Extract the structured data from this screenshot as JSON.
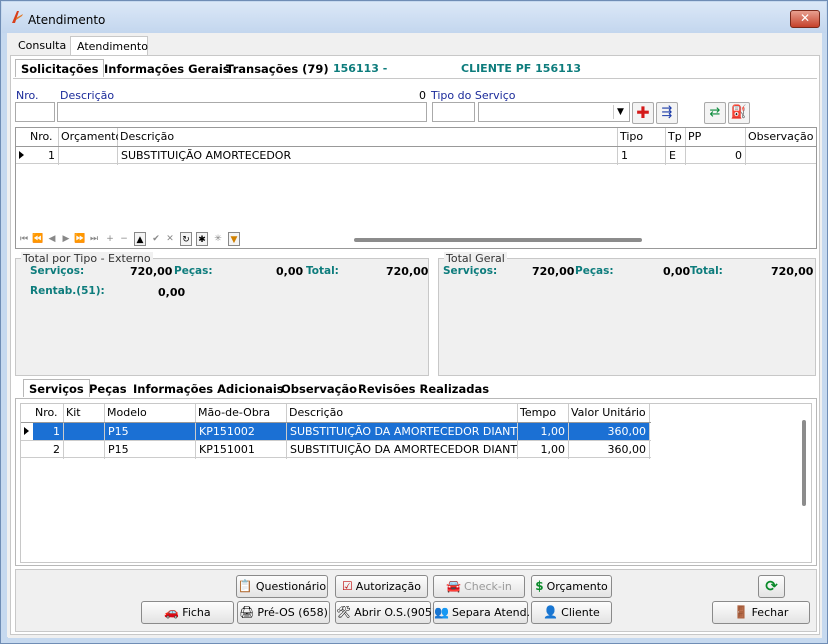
{
  "window": {
    "title": "Atendimento"
  },
  "top_tabs": [
    "Consulta",
    "Atendimento"
  ],
  "sub_tabs": [
    "Solicitações",
    "Informações Gerais",
    "Transações (79)"
  ],
  "header_info": {
    "number": "156113 -",
    "client": "CLIENTE PF 156113"
  },
  "form": {
    "nro_label": "Nro.",
    "descricao_label": "Descrição",
    "descricao_count": "0",
    "tipo_servico_label": "Tipo do Serviço"
  },
  "requests_grid": {
    "columns": [
      "Nro.",
      "Orçamento",
      "Descrição",
      "Tipo",
      "Tp",
      "PP",
      "Observação"
    ],
    "rows": [
      {
        "nro": "1",
        "orcamento": "",
        "descricao": "SUBSTITUIÇÃO AMORTECEDOR",
        "tipo": "1",
        "tp": "E",
        "pp": "0",
        "observacao": ""
      }
    ]
  },
  "totals_external": {
    "title": "Total por Tipo - Externo",
    "servicos_label": "Serviços:",
    "servicos_value": "720,00",
    "pecas_label": "Peças:",
    "pecas_value": "0,00",
    "total_label": "Total:",
    "total_value": "720,00",
    "rentab_label": "Rentab.(51):",
    "rentab_value": "0,00"
  },
  "totals_general": {
    "title": "Total Geral",
    "servicos_label": "Serviços:",
    "servicos_value": "720,00",
    "pecas_label": "Peças:",
    "pecas_value": "0,00",
    "total_label": "Total:",
    "total_value": "720,00"
  },
  "lower_tabs": [
    "Serviços",
    "Peças",
    "Informações Adicionais",
    "Observação",
    "Revisões Realizadas"
  ],
  "services_grid": {
    "columns": [
      "Nro.",
      "Kit",
      "Modelo",
      "Mão-de-Obra",
      "Descrição",
      "Tempo",
      "Valor Unitário"
    ],
    "rows": [
      {
        "nro": "1",
        "kit": "",
        "modelo": "P15",
        "mao_obra": "KP151002",
        "descricao": "SUBSTITUIÇÃO DA AMORTECEDOR DIANTEI",
        "tempo": "1,00",
        "valor": "360,00"
      },
      {
        "nro": "2",
        "kit": "",
        "modelo": "P15",
        "mao_obra": "KP151001",
        "descricao": "SUBSTITUIÇÃO DA AMORTECEDOR DIANTEI",
        "tempo": "1,00",
        "valor": "360,00"
      }
    ]
  },
  "buttons": {
    "questionario": "Questionário",
    "autorizacao": "Autorização",
    "checkin": "Check-in",
    "orcamento": "Orçamento",
    "ficha": "Ficha",
    "pre_os": "Pré-OS (658)",
    "abrir_os": "Abrir O.S.(905)",
    "separa": "Separa Atend.",
    "cliente": "Cliente",
    "fechar": "Fechar"
  },
  "colors": {
    "selection": "#1b70d4",
    "teal": "#0d7c7c",
    "label_blue": "#1a2a9a"
  }
}
